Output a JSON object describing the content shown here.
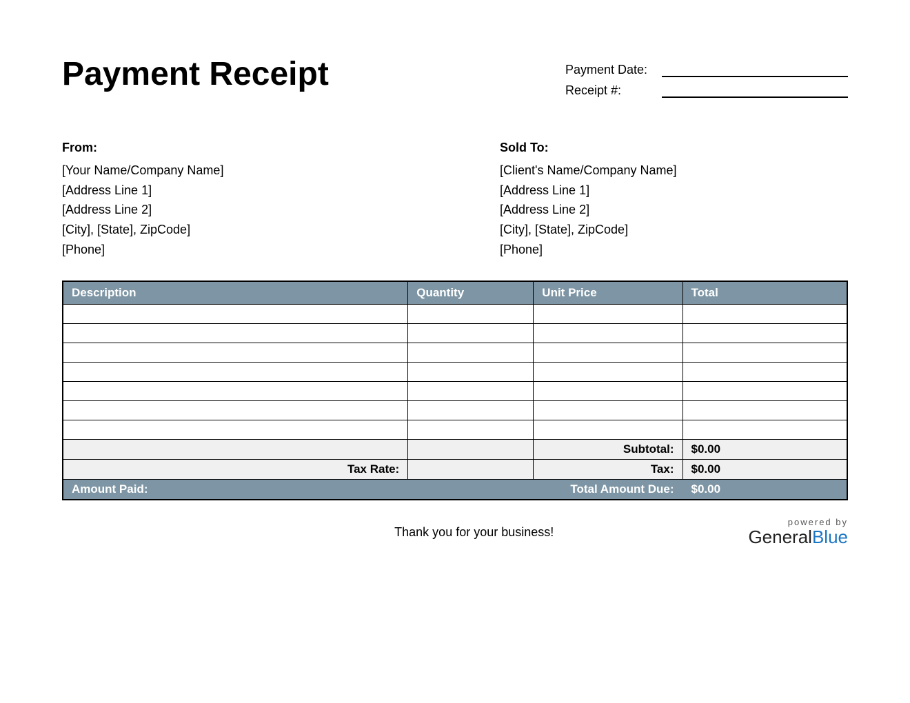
{
  "title": "Payment Receipt",
  "meta": {
    "payment_date_label": "Payment Date:",
    "receipt_no_label": "Receipt #:",
    "payment_date_value": "",
    "receipt_no_value": ""
  },
  "from": {
    "heading": "From:",
    "lines": [
      "[Your Name/Company Name]",
      "[Address Line 1]",
      "[Address Line 2]",
      "[City], [State], ZipCode]",
      "[Phone]"
    ]
  },
  "sold_to": {
    "heading": "Sold To:",
    "lines": [
      "[Client's Name/Company Name]",
      "[Address Line 1]",
      "[Address Line 2]",
      "[City], [State], ZipCode]",
      "[Phone]"
    ]
  },
  "table": {
    "headers": {
      "description": "Description",
      "quantity": "Quantity",
      "unit_price": "Unit Price",
      "total": "Total"
    },
    "rows": [
      {
        "description": "",
        "quantity": "",
        "unit_price": "",
        "total": ""
      },
      {
        "description": "",
        "quantity": "",
        "unit_price": "",
        "total": ""
      },
      {
        "description": "",
        "quantity": "",
        "unit_price": "",
        "total": ""
      },
      {
        "description": "",
        "quantity": "",
        "unit_price": "",
        "total": ""
      },
      {
        "description": "",
        "quantity": "",
        "unit_price": "",
        "total": ""
      },
      {
        "description": "",
        "quantity": "",
        "unit_price": "",
        "total": ""
      },
      {
        "description": "",
        "quantity": "",
        "unit_price": "",
        "total": ""
      }
    ],
    "subtotal_label": "Subtotal:",
    "subtotal_value": "$0.00",
    "tax_rate_label": "Tax Rate:",
    "tax_rate_value": "",
    "tax_label": "Tax:",
    "tax_value": "$0.00",
    "amount_paid_label": "Amount Paid:",
    "amount_paid_value": "",
    "total_due_label": "Total Amount Due:",
    "total_due_value": "$0.00"
  },
  "footer": {
    "thanks": "Thank you for your business!",
    "powered_by": "powered by",
    "brand_general": "General",
    "brand_blue": "Blue"
  }
}
